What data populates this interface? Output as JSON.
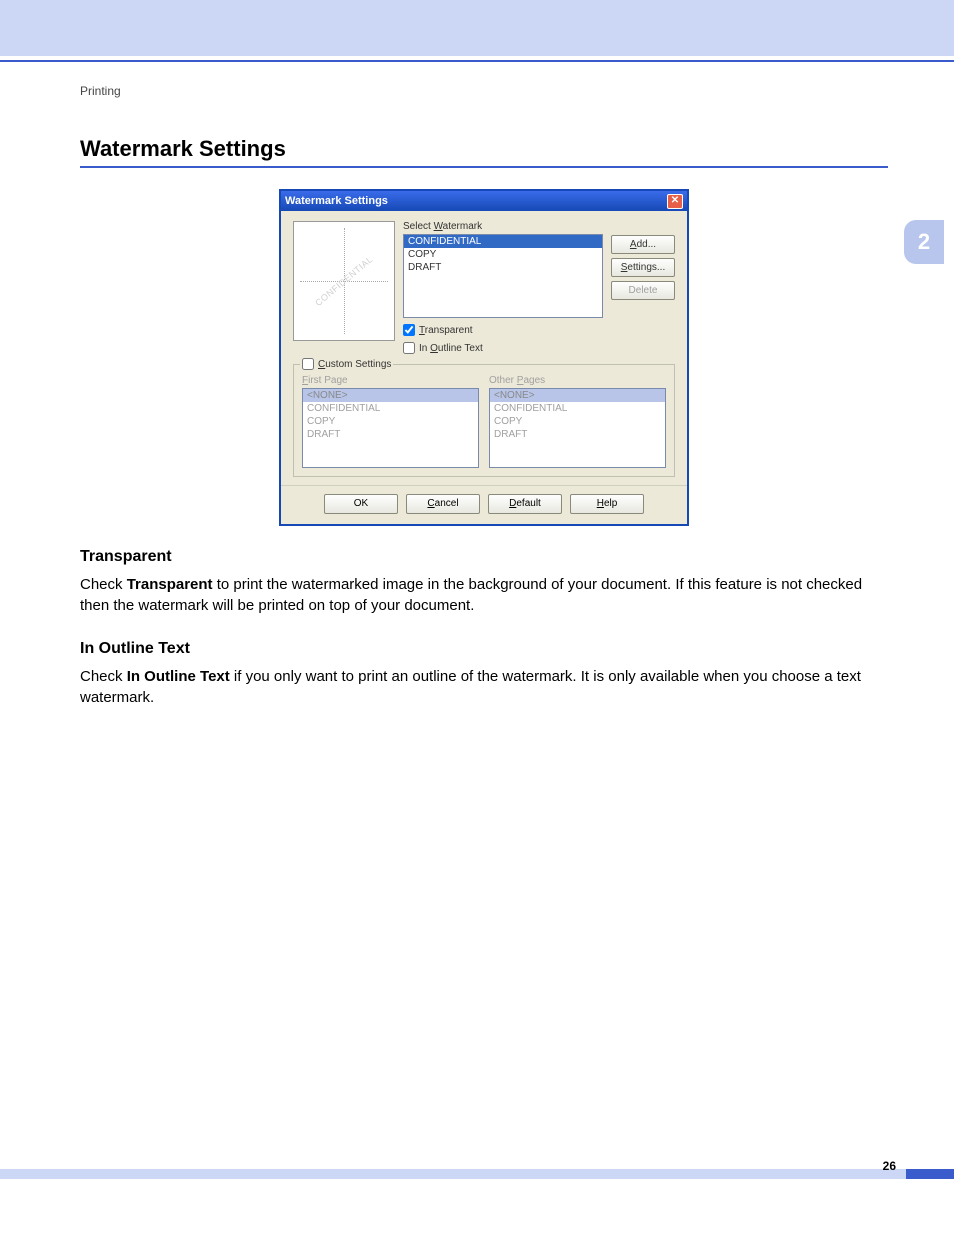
{
  "breadcrumb": "Printing",
  "page_title": "Watermark Settings",
  "side_tab": "2",
  "page_number": "26",
  "dialog": {
    "title": "Watermark Settings",
    "select_label": "Select Watermark",
    "watermarks": [
      "CONFIDENTIAL",
      "COPY",
      "DRAFT"
    ],
    "preview_text": "CONFIDENTIAL",
    "buttons": {
      "add": "Add...",
      "settings": "Settings...",
      "delete": "Delete"
    },
    "transparent_label": "Transparent",
    "transparent_checked": true,
    "outline_label": "In Outline Text",
    "outline_checked": false,
    "custom_settings_label": "Custom Settings",
    "custom_checked": false,
    "first_page_label": "First Page",
    "other_pages_label": "Other Pages",
    "list_options": [
      "<NONE>",
      "CONFIDENTIAL",
      "COPY",
      "DRAFT"
    ],
    "footer": {
      "ok": "OK",
      "cancel": "Cancel",
      "default": "Default",
      "help": "Help"
    }
  },
  "sections": {
    "transparent": {
      "heading": "Transparent",
      "text_before": "Check ",
      "bold": "Transparent",
      "text_after": " to print the watermarked image in the background of your document. If this feature is not checked then the watermark will be printed on top of your document."
    },
    "outline": {
      "heading": "In Outline Text",
      "text_before": "Check ",
      "bold": "In Outline Text",
      "text_after": " if you only want to print an outline of the watermark. It is only available when you choose a text watermark."
    }
  }
}
